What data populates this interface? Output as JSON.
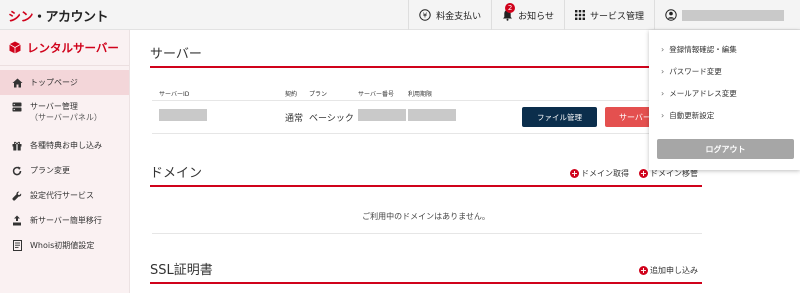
{
  "header": {
    "logo_accent": "シン",
    "logo_rest": "・アカウント",
    "nav": {
      "payment": "料金支払い",
      "notifications": "お知らせ",
      "notification_count": "2",
      "service_manage": "サービス管理"
    }
  },
  "sidebar": {
    "title": "レンタルサーバー",
    "items": [
      {
        "label": "トップページ"
      },
      {
        "label": "サーバー管理",
        "sub": "（サーバーパネル）"
      },
      {
        "label": "各種特典お申し込み"
      },
      {
        "label": "プラン変更"
      },
      {
        "label": "設定代行サービス"
      },
      {
        "label": "新サーバー簡単移行"
      },
      {
        "label": "Whois初期値設定"
      }
    ]
  },
  "server_section": {
    "title": "サーバー",
    "columns": {
      "server_id": "サーバーID",
      "contract": "契約",
      "plan": "プラン",
      "server_number": "サーバー番号",
      "usage_period": "利用期限"
    },
    "row": {
      "contract": "通常",
      "plan": "ベーシック",
      "file_manage_button": "ファイル管理",
      "server_button": "サーバー"
    }
  },
  "domain_section": {
    "title": "ドメイン",
    "acquire": "ドメイン取得",
    "transfer": "ドメイン移管",
    "empty_message": "ご利用中のドメインはありません。"
  },
  "ssl_section": {
    "title": "SSL証明書",
    "add": "追加申し込み"
  },
  "user_menu": {
    "items": [
      {
        "label": "登録情報確認・編集"
      },
      {
        "label": "パスワード変更"
      },
      {
        "label": "メールアドレス変更"
      },
      {
        "label": "自動更新設定"
      }
    ],
    "logout": "ログアウト"
  },
  "colors": {
    "brand_red": "#d0021b",
    "dark_navy": "#0b2e4c",
    "sidebar_bg": "#faf1f2"
  }
}
